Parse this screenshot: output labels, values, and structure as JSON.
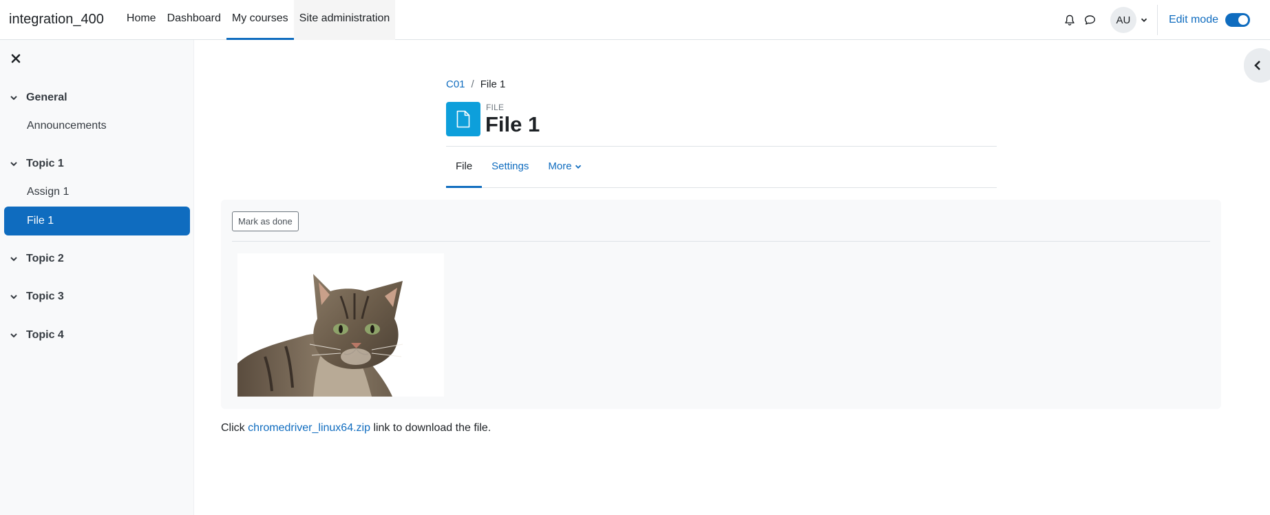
{
  "navbar": {
    "brand": "integration_400",
    "links": [
      "Home",
      "Dashboard",
      "My courses",
      "Site administration"
    ],
    "user_initials": "AU",
    "edit_mode_label": "Edit mode"
  },
  "course_index": {
    "sections": [
      {
        "title": "General",
        "items": [
          "Announcements"
        ]
      },
      {
        "title": "Topic 1",
        "items": [
          "Assign 1",
          "File 1"
        ]
      },
      {
        "title": "Topic 2",
        "items": []
      },
      {
        "title": "Topic 3",
        "items": []
      },
      {
        "title": "Topic 4",
        "items": []
      }
    ],
    "active_item": "File 1"
  },
  "breadcrumb": {
    "course": "C01",
    "separator": "/",
    "current": "File 1"
  },
  "header": {
    "activity_type": "FILE",
    "title": "File 1"
  },
  "tabs": [
    "File",
    "Settings",
    "More"
  ],
  "content": {
    "mark_done_label": "Mark as done",
    "download_prefix": "Click",
    "download_link": "chromedriver_linux64.zip",
    "download_suffix": "link to download the file."
  },
  "colors": {
    "accent": "#0f6cbf",
    "file_icon_bg": "#0d9fdb",
    "drawer_bg": "#f8f9fa"
  }
}
